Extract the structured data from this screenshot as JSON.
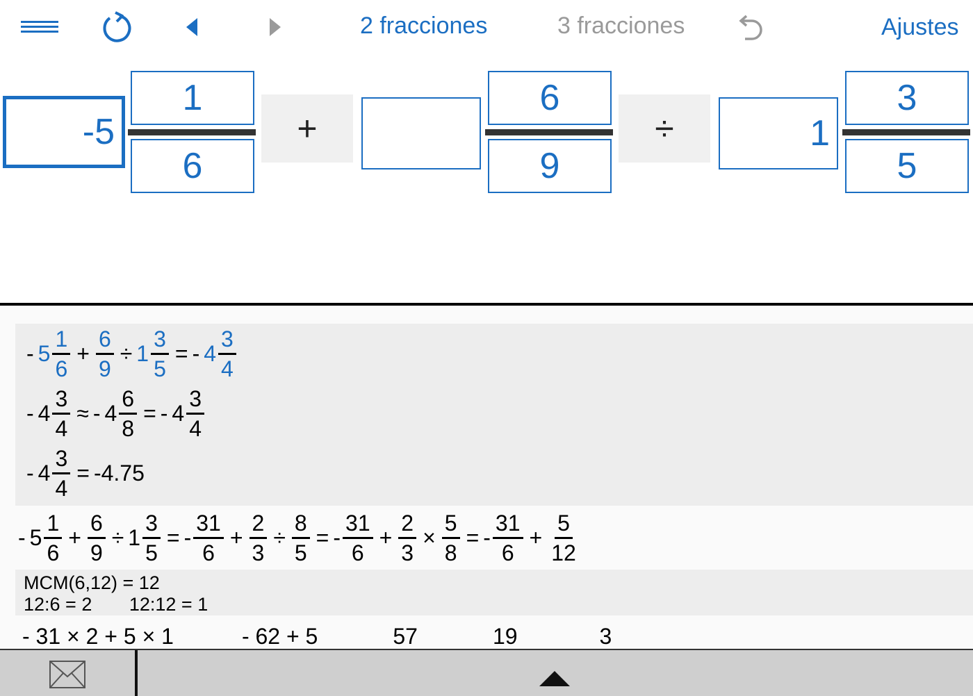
{
  "toolbar": {
    "tab_two": "2 fracciones",
    "tab_three": "3 fracciones",
    "settings_label": "Ajustes",
    "accent_color": "#1b6ec2",
    "inactive_color": "#9a9a9a",
    "icons": [
      "menu-icon",
      "reload-icon",
      "prev-icon",
      "next-icon",
      "undo-icon"
    ]
  },
  "input": {
    "fraction1": {
      "whole": "-5",
      "numerator": "1",
      "denominator": "6"
    },
    "operator1": "+",
    "fraction2": {
      "whole": "",
      "numerator": "6",
      "denominator": "9"
    },
    "operator2": "÷",
    "fraction3": {
      "whole": "1",
      "numerator": "3",
      "denominator": "5"
    }
  },
  "results": {
    "line1": {
      "a_sign": "-",
      "a_whole": "5",
      "a_num": "1",
      "a_den": "6",
      "op1": "+",
      "b_num": "6",
      "b_den": "9",
      "op2": "÷",
      "c_whole": "1",
      "c_num": "3",
      "c_den": "5",
      "eq": "=",
      "r_sign": "-",
      "r_whole": "4",
      "r_num": "3",
      "r_den": "4"
    },
    "line2": {
      "a_sign": "-",
      "a_whole": "4",
      "a_num": "3",
      "a_den": "4",
      "approx": "≈",
      "b_sign": "-",
      "b_whole": "4",
      "b_num": "6",
      "b_den": "8",
      "eq": "=",
      "c_sign": "-",
      "c_whole": "4",
      "c_num": "3",
      "c_den": "4"
    },
    "line3": {
      "a_sign": "-",
      "a_whole": "4",
      "a_num": "3",
      "a_den": "4",
      "eq": "=",
      "decimal": "-4.75"
    },
    "line4": {
      "a_sign": "-",
      "a_whole": "5",
      "a_num": "1",
      "a_den": "6",
      "op1": "+",
      "b_num": "6",
      "b_den": "9",
      "op2": "÷",
      "c_whole": "1",
      "c_num": "3",
      "c_den": "5",
      "eq1": "=",
      "s1_sign": "-",
      "s1_num1": "31",
      "s1_den1": "6",
      "s1_op1": "+",
      "s1_num2": "2",
      "s1_den2": "3",
      "s1_op2": "÷",
      "s1_num3": "8",
      "s1_den3": "5",
      "eq2": "=",
      "s2_sign": "-",
      "s2_num1": "31",
      "s2_den1": "6",
      "s2_op1": "+",
      "s2_num2": "2",
      "s2_den2": "3",
      "s2_op2": "×",
      "s2_num3": "5",
      "s2_den3": "8",
      "eq3": "=",
      "s3_sign": "-",
      "s3_num1": "31",
      "s3_den1": "6",
      "s3_op1": "+",
      "s3_num2": "5",
      "s3_den2": "12"
    },
    "mcm": {
      "line1": "MCM(6,12) = 12",
      "line2a": "12:6 = 2",
      "line2b": "12:12 = 1"
    },
    "line5": {
      "t1": "- 31 × 2 + 5 × 1",
      "t2": "- 62 + 5",
      "t3": "57",
      "t4": "19",
      "t5": "3"
    }
  },
  "bottombar": {
    "icons": [
      "mail-icon",
      "up-arrow-icon"
    ]
  }
}
